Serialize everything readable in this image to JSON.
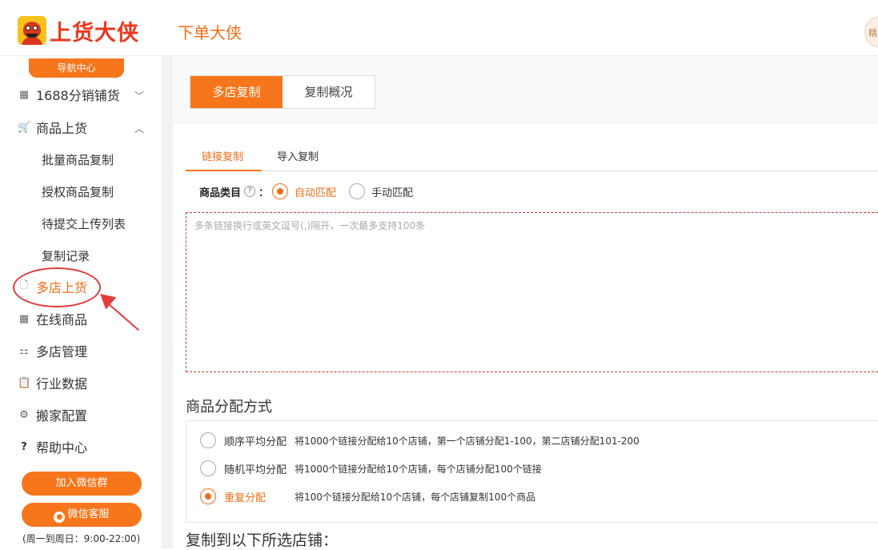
{
  "header": {
    "logo_text": "上货大侠",
    "app_title": "下单大侠",
    "avatar_text": "精"
  },
  "sidebar": {
    "nav_center": "导航中心",
    "items": [
      {
        "label": "1688分销铺货",
        "icon": "grid-icon",
        "caret": "﹀"
      },
      {
        "label": "商品上货",
        "icon": "cart-icon",
        "caret": "︿"
      },
      {
        "label": "多店上货",
        "icon": "document-icon"
      },
      {
        "label": "在线商品",
        "icon": "grid-icon"
      },
      {
        "label": "多店管理",
        "icon": "stores-icon"
      },
      {
        "label": "行业数据",
        "icon": "clipboard-icon"
      },
      {
        "label": "搬家配置",
        "icon": "gear-icon"
      },
      {
        "label": "帮助中心",
        "icon": "question-icon"
      }
    ],
    "sub_items": [
      "批量商品复制",
      "授权商品复制",
      "待提交上传列表",
      "复制记录"
    ],
    "buttons": {
      "wechat_group": "加入微信群",
      "wechat_service": "微信客服"
    },
    "hours": "(周一到周日：9:00-22:00)"
  },
  "tabs": [
    "多店复制",
    "复制概况"
  ],
  "subtabs": [
    "链接复制",
    "导入复制"
  ],
  "category": {
    "label": "商品类目",
    "help": "?",
    "colon": "：",
    "options": [
      "自动匹配",
      "手动匹配"
    ],
    "selected": "自动匹配"
  },
  "links_input": {
    "placeholder": "多条链接换行或英文逗号(,)隔开，一次最多支持100条"
  },
  "distribution": {
    "title": "商品分配方式",
    "options": [
      {
        "label": "顺序平均分配",
        "desc": "将1000个链接分配给10个店铺，第一个店铺分配1-100，第二店铺分配101-200"
      },
      {
        "label": "随机平均分配",
        "desc": "将1000个链接分配给10个店铺，每个店铺分配100个链接"
      },
      {
        "label": "重复分配",
        "desc": "将100个链接分配给10个店铺，每个店铺复制100个商品"
      }
    ],
    "selected": "重复分配"
  },
  "copy_to": {
    "title": "复制到以下所选店铺："
  },
  "colors": {
    "accent": "#f7761c",
    "annotation": "#e23b3b"
  }
}
